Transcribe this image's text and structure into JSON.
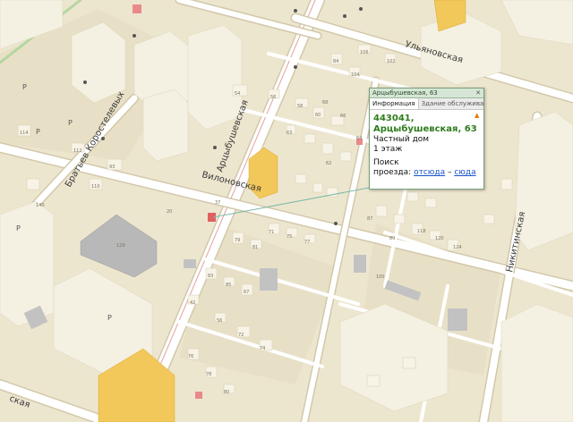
{
  "streets": {
    "arcybushevskaya": "Арцыбушевская",
    "vilonovskaya": "Вилоновская",
    "ulyanovskaya": "Ульяновская",
    "nikitinskaya": "Никитинская",
    "bratyev_korostelevyh": "Братьев Коростелевых",
    "bottom_fragment": "ская"
  },
  "poi_letter": "P",
  "building_numbers": [
    "20",
    "37",
    "129",
    "140",
    "62",
    "64",
    "66",
    "68",
    "54",
    "56",
    "58",
    "60",
    "63",
    "87",
    "100",
    "89",
    "71",
    "75",
    "77",
    "79",
    "81",
    "83",
    "85",
    "67",
    "42",
    "56",
    "118",
    "120",
    "124",
    "72",
    "74",
    "76",
    "78",
    "80",
    "84",
    "104",
    "106",
    "102",
    "93",
    "110",
    "112",
    "114"
  ],
  "popup": {
    "title": "Арцыбушевская, 63",
    "tab_info": "Информация",
    "tab_building": "Здание обслужива...",
    "address_line1": "443041,",
    "address_line2": "Арцыбушевская, 63",
    "type": "Частный дом",
    "floors": "1 этаж",
    "route_prefix": "Поиск",
    "route_label": "проезда:",
    "route_from": "отсюда",
    "route_dash": "–",
    "route_to": "сюда"
  },
  "colors": {
    "background": "#ede6cf",
    "building": "#f7f3e6",
    "road": "#ffffff",
    "road_edge": "#d2c8aa",
    "highlight_building": "#f2c85a",
    "gray_block": "#b8b8b8",
    "popup_border": "#7aa07a",
    "address_green": "#2e7d1e",
    "link_blue": "#1a55c8"
  }
}
